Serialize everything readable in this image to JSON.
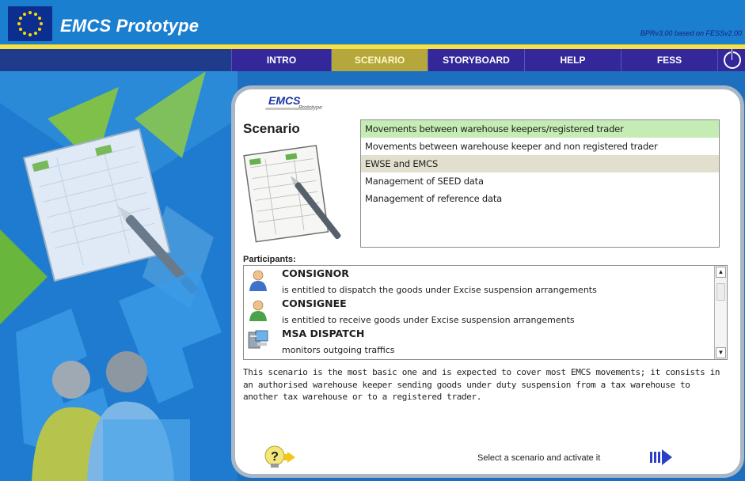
{
  "header": {
    "title": "EMCS Prototype",
    "version": "BPRv3.00 based on FESSv2.00",
    "flag_icon": "eu-flag-icon"
  },
  "nav": {
    "tabs": [
      {
        "label": "INTRO"
      },
      {
        "label": "SCENARIO"
      },
      {
        "label": "STORYBOARD"
      },
      {
        "label": "HELP"
      },
      {
        "label": "FESS"
      }
    ],
    "active_tab": "SCENARIO",
    "power_icon": "power-icon"
  },
  "card": {
    "logo_main": "EMCS",
    "logo_sub": "Prototype",
    "heading": "Scenario",
    "scenarios": [
      {
        "label": "Movements between warehouse keepers/registered trader",
        "highlight": "green"
      },
      {
        "label": "Movements between warehouse keeper and non registered trader",
        "highlight": ""
      },
      {
        "label": "EWSE and EMCS",
        "highlight": "grey"
      },
      {
        "label": "Management of SEED data",
        "highlight": ""
      },
      {
        "label": "Management of reference data",
        "highlight": ""
      }
    ],
    "participants_label": "Participants:",
    "participants": [
      {
        "name": "CONSIGNOR",
        "desc": "is entitled to dispatch the goods under Excise suspension arrangements",
        "icon": "person-blue-icon"
      },
      {
        "name": "CONSIGNEE",
        "desc": "is entitled to receive goods under Excise suspension arrangements",
        "icon": "person-green-icon"
      },
      {
        "name": "MSA DISPATCH",
        "desc": "monitors outgoing traffics",
        "icon": "computer-icon"
      }
    ],
    "description": "This scenario is the most basic one and is expected to cover most EMCS movements; it consists in an authorised warehouse keeper sending goods under duty suspension from a tax warehouse to another tax warehouse or to a registered trader.",
    "activate_text": "Select a scenario and activate it",
    "help_icon": "help-bulb-icon",
    "activate_icon": "activate-arrow-icon"
  },
  "colors": {
    "background": "#1d6fc0",
    "nav": "#33279a",
    "active_tab": "#b5a73b",
    "highlight_green": "#c4ecb4",
    "highlight_grey": "#e3dfcf"
  }
}
